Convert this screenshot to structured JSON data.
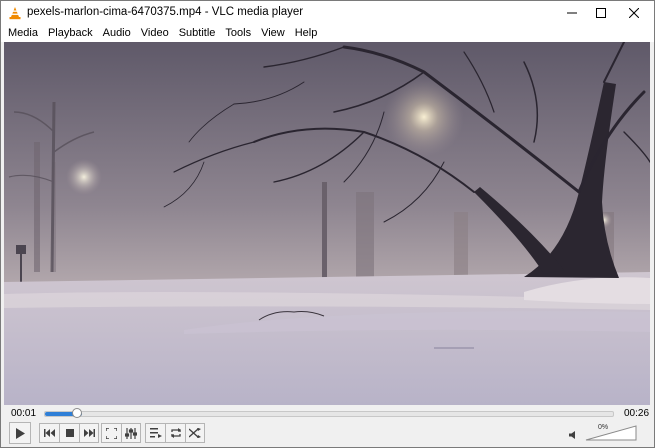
{
  "window": {
    "title": "pexels-marlon-cima-6470375.mp4 - VLC media player"
  },
  "menu": {
    "items": [
      {
        "label": "Media",
        "name": "menu-media"
      },
      {
        "label": "Playback",
        "name": "menu-playback"
      },
      {
        "label": "Audio",
        "name": "menu-audio"
      },
      {
        "label": "Video",
        "name": "menu-video"
      },
      {
        "label": "Subtitle",
        "name": "menu-subtitle"
      },
      {
        "label": "Tools",
        "name": "menu-tools"
      },
      {
        "label": "View",
        "name": "menu-view"
      },
      {
        "label": "Help",
        "name": "menu-help"
      }
    ]
  },
  "playback": {
    "elapsed": "00:01",
    "total": "00:26",
    "progress": 0.065
  },
  "volume": {
    "label": "0%",
    "level": 0
  },
  "colors": {
    "seek_fill": "#2f7fd7",
    "vlc_orange": "#f08a00"
  },
  "icons": {
    "app": "vlc-cone-icon",
    "play": "play-icon",
    "prev": "previous-icon",
    "stop": "stop-icon",
    "next": "next-icon",
    "fullscreen": "fullscreen-icon",
    "extended": "extended-settings-icon",
    "playlist": "playlist-icon",
    "loop": "loop-icon",
    "shuffle": "shuffle-icon",
    "mute": "speaker-icon"
  }
}
